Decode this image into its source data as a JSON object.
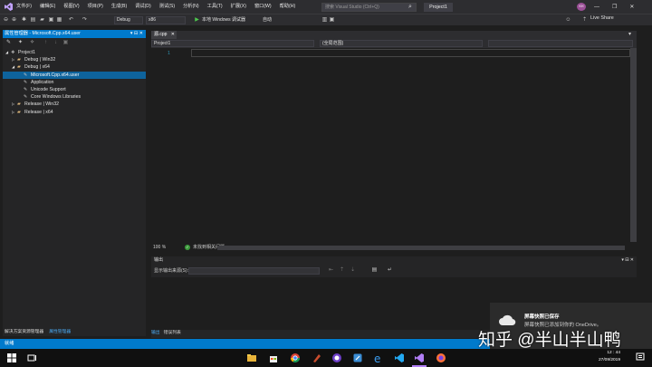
{
  "menu": [
    "文件(F)",
    "编辑(E)",
    "视图(V)",
    "项目(P)",
    "生成(B)",
    "调试(D)",
    "测试(S)",
    "分析(N)",
    "工具(T)",
    "扩展(X)",
    "窗口(W)",
    "帮助(H)"
  ],
  "search_placeholder": "搜索 Visual Studio (Ctrl+Q)",
  "project_title": "Project1",
  "user_initials": "KH",
  "toolbar": {
    "config": "Debug",
    "platform": "x86",
    "run_label": "本地 Windows 调试器",
    "run_mode": "自动",
    "live_share": "Live Share"
  },
  "left_panel": {
    "title": "属性管理器 - Microsoft.Cpp.x64.user",
    "pin": "▾ ⊟ ✕",
    "tree": [
      {
        "label": "Project1",
        "indent": 0,
        "arrow": "◢",
        "icon": "project"
      },
      {
        "label": "Debug | Win32",
        "indent": 1,
        "arrow": "▷",
        "icon": "folder"
      },
      {
        "label": "Debug | x64",
        "indent": 1,
        "arrow": "◢",
        "icon": "folder"
      },
      {
        "label": "Microsoft.Cpp.x64.user",
        "indent": 2,
        "arrow": "",
        "icon": "wrench",
        "selected": true
      },
      {
        "label": "Application",
        "indent": 2,
        "arrow": "",
        "icon": "wrench"
      },
      {
        "label": "Unicode Support",
        "indent": 2,
        "arrow": "",
        "icon": "wrench"
      },
      {
        "label": "Core Windows Libraries",
        "indent": 2,
        "arrow": "",
        "icon": "wrench"
      },
      {
        "label": "Release | Win32",
        "indent": 1,
        "arrow": "▷",
        "icon": "folder"
      },
      {
        "label": "Release | x64",
        "indent": 1,
        "arrow": "▷",
        "icon": "folder"
      }
    ],
    "tabs": [
      "解决方案资源管理器",
      "属性管理器"
    ],
    "active_tab": 1
  },
  "editor": {
    "tab_label": "源.cpp",
    "project_dd": "Project1",
    "scope_dd": "(全局范围)",
    "line_number": "1",
    "zoom": "100 %",
    "issues": "未找到相关问题"
  },
  "output": {
    "title": "输出",
    "source_label": "显示输出来源(S):",
    "tabs": [
      "输出",
      "错误列表"
    ],
    "active_tab": 0
  },
  "status": "就绪",
  "toast": {
    "title": "屏幕快照已保存",
    "body": "屏幕快照已添加到你的 OneDrive。"
  },
  "watermark": "知乎 @半山半山鸭",
  "clock": {
    "time": "12 : 44",
    "date": "27/09/2019"
  },
  "colors": {
    "accent": "#007acc",
    "vs_purple": "#9b4f96",
    "tab_active": "#4aa8f0"
  }
}
